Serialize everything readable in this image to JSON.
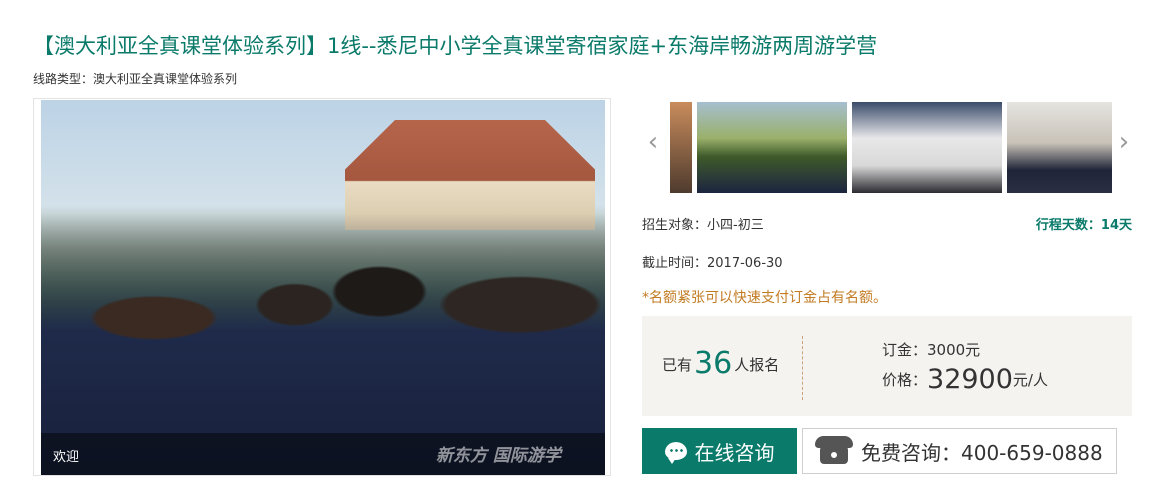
{
  "header": {
    "title": "【澳大利亚全真课堂体验系列】1线--悉尼中小学全真课堂寄宿家庭+东海岸畅游两周游学营",
    "route_type": "线路类型：澳大利亚全真课堂体验系列"
  },
  "gallery": {
    "main_caption": "欢迎",
    "watermark": "新东方 国际游学",
    "prev_icon": "chevron-left-icon",
    "next_icon": "chevron-right-icon",
    "thumbnail_count": 4
  },
  "info": {
    "target": "招生对象：小四-初三",
    "duration": "行程天数：14天",
    "deadline": "截止时间：2017-06-30",
    "notice": "*名额紧张可以快速支付订金占有名额。"
  },
  "price_box": {
    "enrolled_prefix": "已有",
    "enrolled_count": "36",
    "enrolled_suffix": "人报名",
    "deposit": "订金：3000元",
    "price_label": "价格：",
    "price_amount": "32900",
    "price_unit": "元/人"
  },
  "actions": {
    "consult_label": "在线咨询",
    "phone_label": "免费咨询：400-659-0888"
  },
  "colors": {
    "accent": "#0a7a6a",
    "notice": "#c27b22",
    "price_bg": "#f5f3f0"
  }
}
